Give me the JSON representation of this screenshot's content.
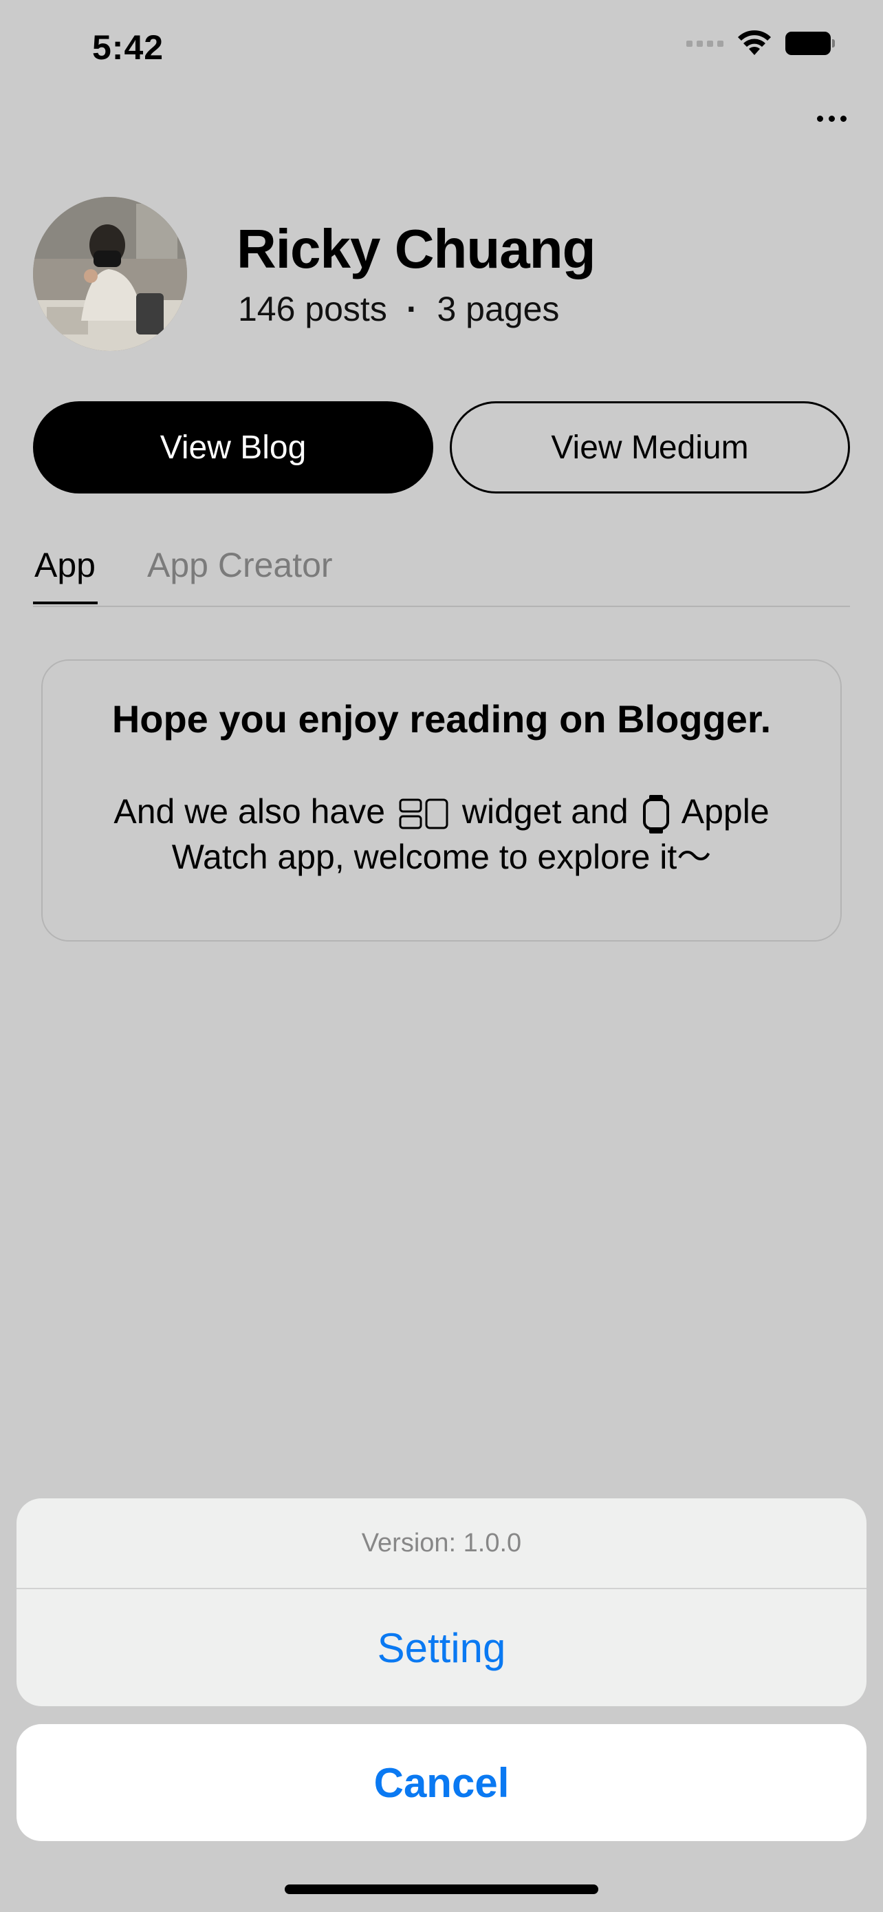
{
  "status_bar": {
    "time": "5:42"
  },
  "profile": {
    "name": "Ricky Chuang",
    "posts": "146 posts",
    "separator": "·",
    "pages": "3 pages"
  },
  "buttons": {
    "blog": "View Blog",
    "medium": "View Medium"
  },
  "tabs": [
    {
      "label": "App",
      "selected": true
    },
    {
      "label": "App Creator",
      "selected": false
    }
  ],
  "card": {
    "title": "Hope you enjoy reading on Blogger.",
    "body_part1": "And we also have",
    "body_part2": "widget and",
    "body_part3": "Apple Watch app, welcome to explore it～"
  },
  "action_sheet": {
    "version": "Version: 1.0.0",
    "setting": "Setting",
    "cancel": "Cancel"
  },
  "icons": [
    "signal-icon",
    "wifi-icon",
    "battery-icon",
    "more-icon",
    "widget-icon",
    "apple-watch-icon"
  ],
  "colors": {
    "accent": "#0A79F2",
    "background": "#CBCBCB",
    "sheet": "#EFF0EF"
  }
}
